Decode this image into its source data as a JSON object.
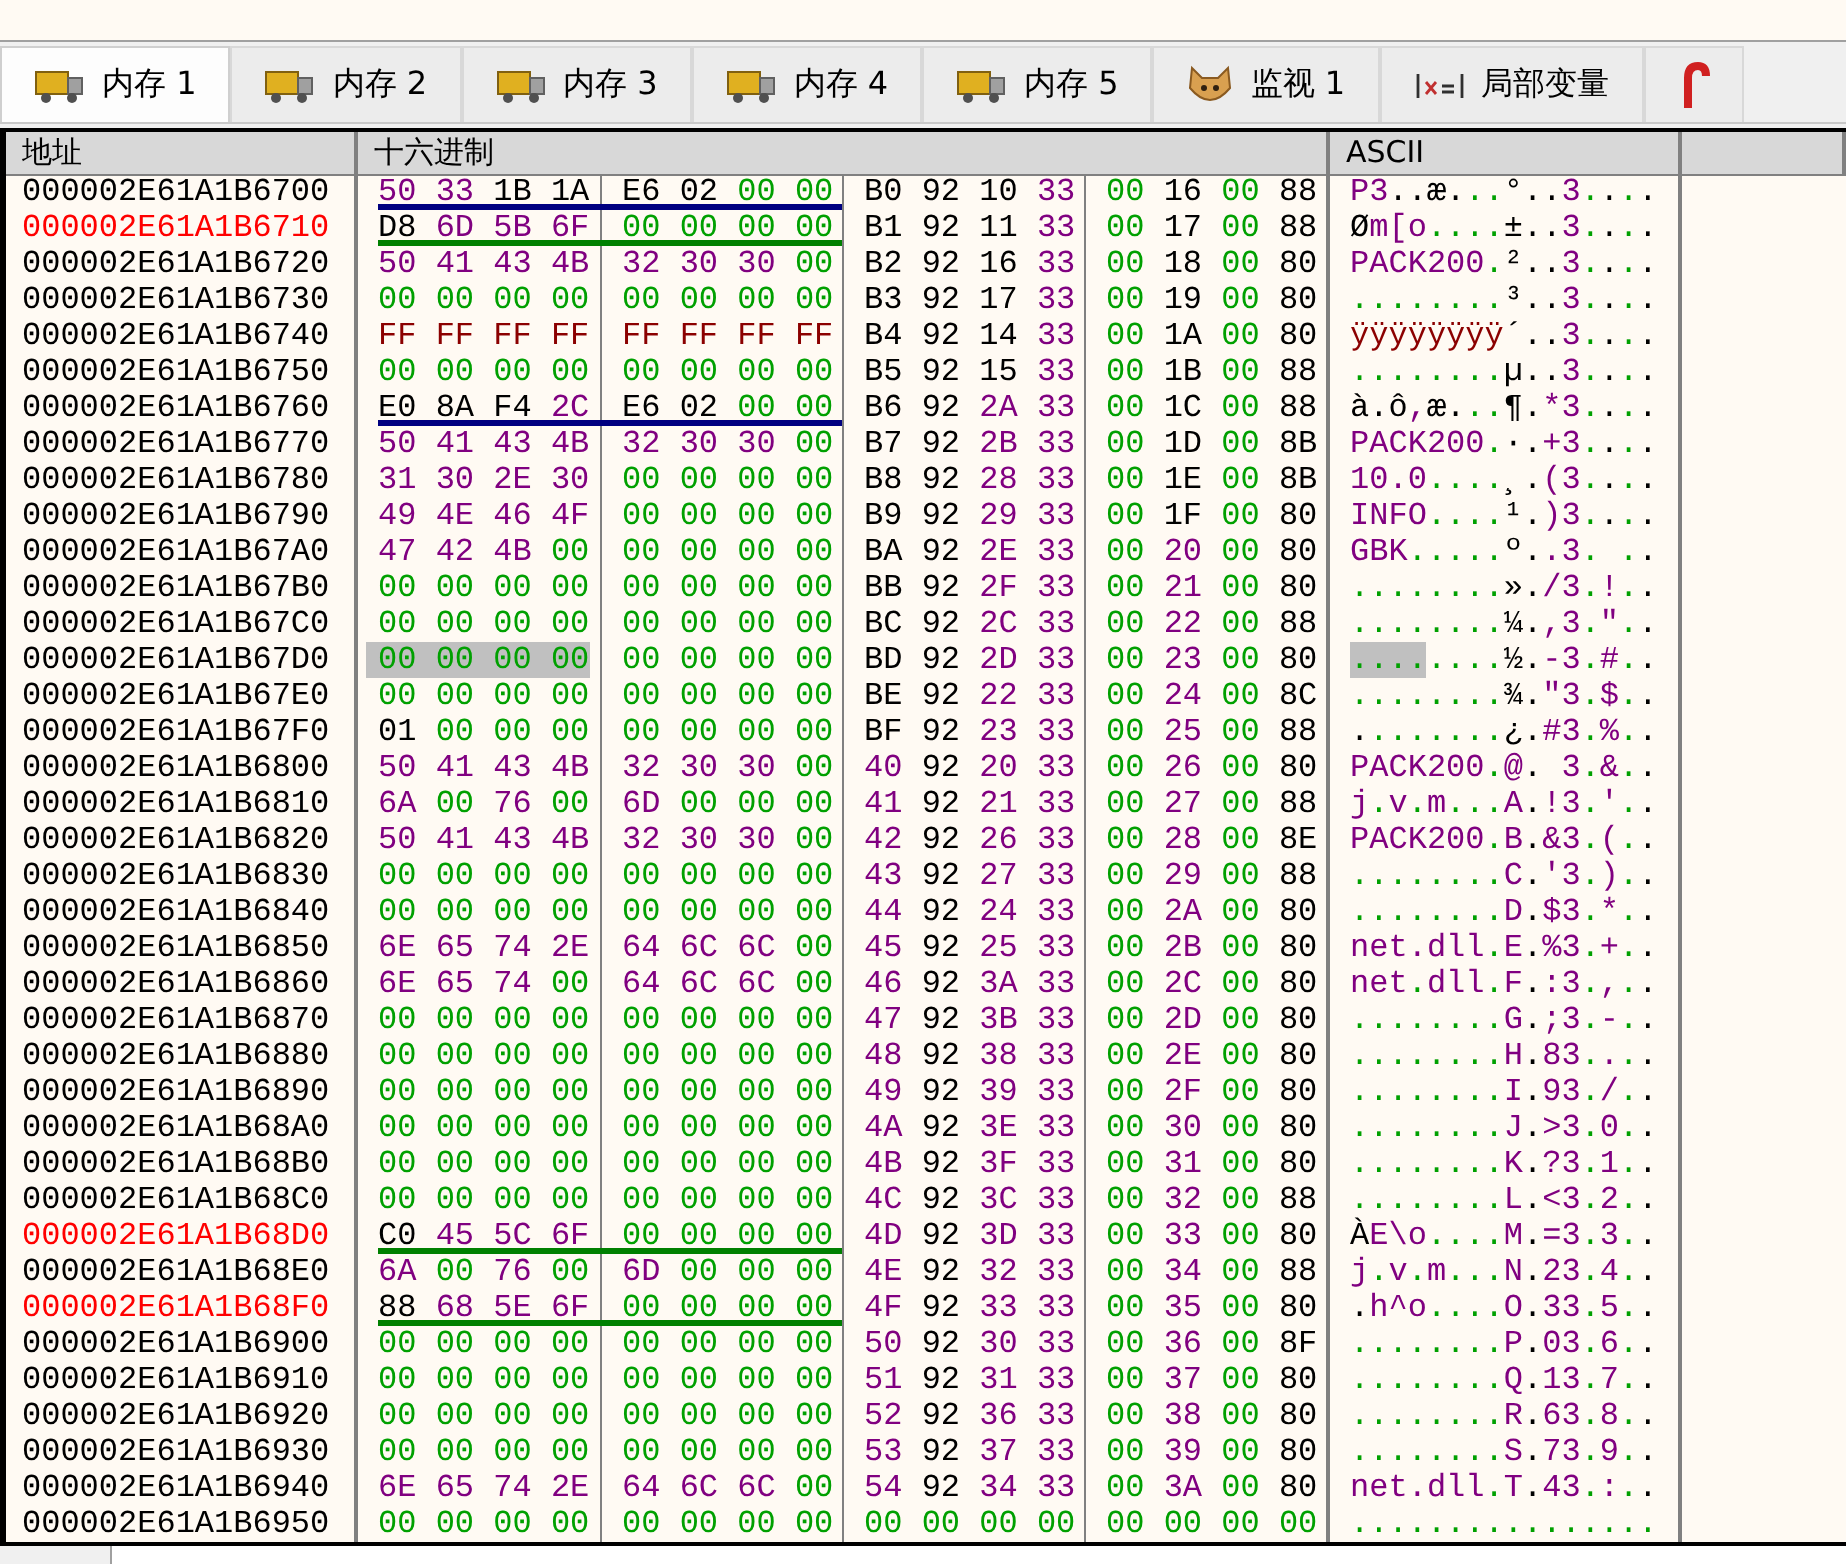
{
  "tabs": [
    {
      "label": "内存 1",
      "kind": "memory",
      "selected": true
    },
    {
      "label": "内存 2",
      "kind": "memory",
      "selected": false
    },
    {
      "label": "内存 3",
      "kind": "memory",
      "selected": false
    },
    {
      "label": "内存 4",
      "kind": "memory",
      "selected": false
    },
    {
      "label": "内存 5",
      "kind": "memory",
      "selected": false
    },
    {
      "label": "监视 1",
      "kind": "watch",
      "selected": false
    },
    {
      "label": "局部变量",
      "kind": "locals",
      "selected": false
    },
    {
      "kind": "cane",
      "selected": false
    }
  ],
  "columns": [
    "地址",
    "十六进制",
    "ASCII"
  ],
  "rows": [
    {
      "address": "000002E61A1B6700",
      "marked": false,
      "selected": false,
      "color": "#000080",
      "hex": "50 33 1B 1A E6 02 00 00 B0 92 10 33 00 16 00 88",
      "ascii": "P3..æ...°..3...."
    },
    {
      "address": "000002E61A1B6710",
      "marked": true,
      "selected": false,
      "color": "#008000",
      "hex": "D8 6D 5B 6F 00 00 00 00 B1 92 11 33 00 17 00 88",
      "ascii": "Øm[o....±..3...."
    },
    {
      "address": "000002E61A1B6720",
      "marked": false,
      "selected": false,
      "hex": "50 41 43 4B 32 30 30 00 B2 92 16 33 00 18 00 80",
      "ascii": "PACK200.²..3...."
    },
    {
      "address": "000002E61A1B6730",
      "marked": false,
      "selected": false,
      "hex": "00 00 00 00 00 00 00 00 B3 92 17 33 00 19 00 80",
      "ascii": "........³..3...."
    },
    {
      "address": "000002E61A1B6740",
      "marked": false,
      "selected": false,
      "hex": "FF FF FF FF FF FF FF FF B4 92 14 33 00 1A 00 80",
      "ascii": "ÿÿÿÿÿÿÿÿ´..3...."
    },
    {
      "address": "000002E61A1B6750",
      "marked": false,
      "selected": false,
      "hex": "00 00 00 00 00 00 00 00 B5 92 15 33 00 1B 00 88",
      "ascii": "........µ..3...."
    },
    {
      "address": "000002E61A1B6760",
      "marked": false,
      "selected": false,
      "color": "#000080",
      "hex": "E0 8A F4 2C E6 02 00 00 B6 92 2A 33 00 1C 00 88",
      "ascii": "à.ô,æ...¶.*3...."
    },
    {
      "address": "000002E61A1B6770",
      "marked": false,
      "selected": false,
      "hex": "50 41 43 4B 32 30 30 00 B7 92 2B 33 00 1D 00 8B",
      "ascii": "PACK200.·.+3...."
    },
    {
      "address": "000002E61A1B6780",
      "marked": false,
      "selected": false,
      "hex": "31 30 2E 30 00 00 00 00 B8 92 28 33 00 1E 00 8B",
      "ascii": "10.0....¸.(3...."
    },
    {
      "address": "000002E61A1B6790",
      "marked": false,
      "selected": false,
      "hex": "49 4E 46 4F 00 00 00 00 B9 92 29 33 00 1F 00 80",
      "ascii": "INFO....¹.)3...."
    },
    {
      "address": "000002E61A1B67A0",
      "marked": false,
      "selected": false,
      "hex": "47 42 4B 00 00 00 00 00 BA 92 2E 33 00 20 00 80",
      "ascii": "GBK.....º..3. .."
    },
    {
      "address": "000002E61A1B67B0",
      "marked": false,
      "selected": false,
      "hex": "00 00 00 00 00 00 00 00 BB 92 2F 33 00 21 00 80",
      "ascii": "........»./3.!.."
    },
    {
      "address": "000002E61A1B67C0",
      "marked": false,
      "selected": false,
      "hex": "00 00 00 00 00 00 00 00 BC 92 2C 33 00 22 00 88",
      "ascii": "........¼.,3.\".."
    },
    {
      "address": "000002E61A1B67D0",
      "marked": false,
      "selected": true,
      "hex": "00 00 00 00 00 00 00 00 BD 92 2D 33 00 23 00 80",
      "ascii": "........½.-3.#.."
    },
    {
      "address": "000002E61A1B67E0",
      "marked": false,
      "selected": false,
      "hex": "00 00 00 00 00 00 00 00 BE 92 22 33 00 24 00 8C",
      "ascii": "........¾.\"3.$.."
    },
    {
      "address": "000002E61A1B67F0",
      "marked": false,
      "selected": false,
      "hex": "01 00 00 00 00 00 00 00 BF 92 23 33 00 25 00 88",
      "ascii": "........¿.#3.%.."
    },
    {
      "address": "000002E61A1B6800",
      "marked": false,
      "selected": false,
      "hex": "50 41 43 4B 32 30 30 00 40 92 20 33 00 26 00 80",
      "ascii": "PACK200.@. 3.&.."
    },
    {
      "address": "000002E61A1B6810",
      "marked": false,
      "selected": false,
      "hex": "6A 00 76 00 6D 00 00 00 41 92 21 33 00 27 00 88",
      "ascii": "j.v.m...A.!3.'.."
    },
    {
      "address": "000002E61A1B6820",
      "marked": false,
      "selected": false,
      "hex": "50 41 43 4B 32 30 30 00 42 92 26 33 00 28 00 8E",
      "ascii": "PACK200.B.&3.(.."
    },
    {
      "address": "000002E61A1B6830",
      "marked": false,
      "selected": false,
      "hex": "00 00 00 00 00 00 00 00 43 92 27 33 00 29 00 88",
      "ascii": "........C.'3.).."
    },
    {
      "address": "000002E61A1B6840",
      "marked": false,
      "selected": false,
      "hex": "00 00 00 00 00 00 00 00 44 92 24 33 00 2A 00 80",
      "ascii": "........D.$3.*.."
    },
    {
      "address": "000002E61A1B6850",
      "marked": false,
      "selected": false,
      "hex": "6E 65 74 2E 64 6C 6C 00 45 92 25 33 00 2B 00 80",
      "ascii": "net.dll.E.%3.+.."
    },
    {
      "address": "000002E61A1B6860",
      "marked": false,
      "selected": false,
      "hex": "6E 65 74 00 64 6C 6C 00 46 92 3A 33 00 2C 00 80",
      "ascii": "net.dll.F.:3.,.."
    },
    {
      "address": "000002E61A1B6870",
      "marked": false,
      "selected": false,
      "hex": "00 00 00 00 00 00 00 00 47 92 3B 33 00 2D 00 80",
      "ascii": "........G.;3.-.."
    },
    {
      "address": "000002E61A1B6880",
      "marked": false,
      "selected": false,
      "hex": "00 00 00 00 00 00 00 00 48 92 38 33 00 2E 00 80",
      "ascii": "........H.83...."
    },
    {
      "address": "000002E61A1B6890",
      "marked": false,
      "selected": false,
      "hex": "00 00 00 00 00 00 00 00 49 92 39 33 00 2F 00 80",
      "ascii": "........I.93./.."
    },
    {
      "address": "000002E61A1B68A0",
      "marked": false,
      "selected": false,
      "hex": "00 00 00 00 00 00 00 00 4A 92 3E 33 00 30 00 80",
      "ascii": "........J.>3.0.."
    },
    {
      "address": "000002E61A1B68B0",
      "marked": false,
      "selected": false,
      "hex": "00 00 00 00 00 00 00 00 4B 92 3F 33 00 31 00 80",
      "ascii": "........K.?3.1.."
    },
    {
      "address": "000002E61A1B68C0",
      "marked": false,
      "selected": false,
      "hex": "00 00 00 00 00 00 00 00 4C 92 3C 33 00 32 00 88",
      "ascii": "........L.<3.2.."
    },
    {
      "address": "000002E61A1B68D0",
      "marked": true,
      "selected": false,
      "color": "#008000",
      "hex": "C0 45 5C 6F 00 00 00 00 4D 92 3D 33 00 33 00 80",
      "ascii": "ÀE\\o....M.=3.3.."
    },
    {
      "address": "000002E61A1B68E0",
      "marked": false,
      "selected": false,
      "hex": "6A 00 76 00 6D 00 00 00 4E 92 32 33 00 34 00 88",
      "ascii": "j.v.m...N.23.4.."
    },
    {
      "address": "000002E61A1B68F0",
      "marked": true,
      "selected": false,
      "color": "#008000",
      "hex": "88 68 5E 6F 00 00 00 00 4F 92 33 33 00 35 00 80",
      "ascii": ".h^o....O.33.5.."
    },
    {
      "address": "000002E61A1B6900",
      "marked": false,
      "selected": false,
      "hex": "00 00 00 00 00 00 00 00 50 92 30 33 00 36 00 8F",
      "ascii": "........P.03.6.."
    },
    {
      "address": "000002E61A1B6910",
      "marked": false,
      "selected": false,
      "hex": "00 00 00 00 00 00 00 00 51 92 31 33 00 37 00 80",
      "ascii": "........Q.13.7.."
    },
    {
      "address": "000002E61A1B6920",
      "marked": false,
      "selected": false,
      "hex": "00 00 00 00 00 00 00 00 52 92 36 33 00 38 00 80",
      "ascii": "........R.63.8.."
    },
    {
      "address": "000002E61A1B6930",
      "marked": false,
      "selected": false,
      "hex": "00 00 00 00 00 00 00 00 53 92 37 33 00 39 00 80",
      "ascii": "........S.73.9.."
    },
    {
      "address": "000002E61A1B6940",
      "marked": false,
      "selected": false,
      "hex": "6E 65 74 2E 64 6C 6C 00 54 92 34 33 00 3A 00 80",
      "ascii": "net.dll.T.43.:.."
    },
    {
      "address": "000002E61A1B6950",
      "marked": false,
      "selected": false,
      "hex": "00 00 00 00 00 00 00 00 00 00 00 00 00 00 00 00",
      "ascii": "................"
    }
  ]
}
